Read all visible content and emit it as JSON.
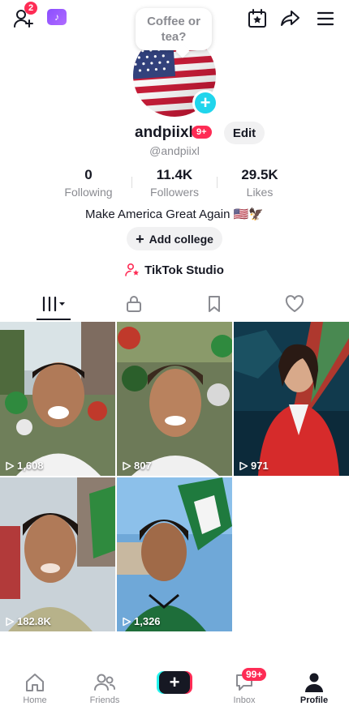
{
  "topbar": {
    "friend_requests_count": "2",
    "promo_icon": "tiktok-note-icon",
    "icons": [
      "add-friend-icon",
      "calendar-star-icon",
      "share-icon",
      "menu-icon"
    ]
  },
  "profile": {
    "note_text": "Coffee or tea?",
    "username": "andpiixl",
    "name_badge": "9+",
    "edit_label": "Edit",
    "handle": "@andpiixl",
    "stats": [
      {
        "value": "0",
        "label": "Following"
      },
      {
        "value": "11.4K",
        "label": "Followers"
      },
      {
        "value": "29.5K",
        "label": "Likes"
      }
    ],
    "bio": "Make America Great Again 🇺🇸🦅",
    "add_college_label": "Add college",
    "studio_label": "TikTok Studio"
  },
  "tabs": [
    "videos-grid-icon",
    "lock-icon",
    "bookmark-icon",
    "heart-icon"
  ],
  "videos": [
    {
      "views": "1,608"
    },
    {
      "views": "807"
    },
    {
      "views": "971"
    },
    {
      "views": "182.8K"
    },
    {
      "views": "1,326"
    }
  ],
  "bottom_nav": {
    "home": "Home",
    "friends": "Friends",
    "inbox": "Inbox",
    "inbox_badge": "99+",
    "profile": "Profile"
  },
  "colors": {
    "accent": "#fe2c55",
    "cyan": "#25f4ee",
    "text": "#161823",
    "muted": "#8a8b91"
  }
}
